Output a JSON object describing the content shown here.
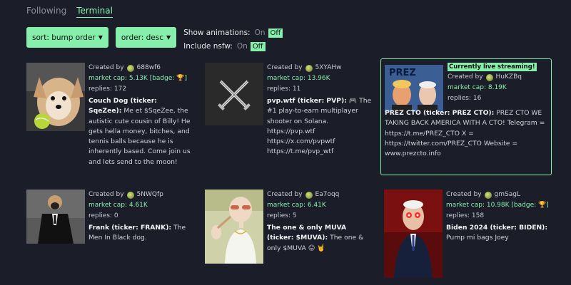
{
  "tabs": [
    "Following",
    "Terminal"
  ],
  "controls": {
    "sort_label": "sort: bump order",
    "order_label": "order: desc",
    "animations_label": "Show animations:",
    "nsfw_label": "Include nsfw:",
    "off_option": "On",
    "on_option": "Off"
  },
  "cards": [
    {
      "created_by": "Created by",
      "user": "688wf6",
      "market_cap": "market cap: 5.13K",
      "badge": "[badge: 🏆]",
      "replies": "replies: 172",
      "name": "Couch Dog (ticker: SqeZee):",
      "text": "Me et $SqeZee, the autistic cute cousin of Billy! He gets hella money, bitches, and tennis balls because he is inherently based. Come join us and lets send to the moon!"
    },
    {
      "created_by": "Created by",
      "user": "5XYAHw",
      "market_cap": "market cap: 13.96K",
      "replies": "replies: 11",
      "name": "pvp.wtf (ticker: PVP):",
      "text": "🎮 The #1 play-to-earn multiplayer shooter on Solana. https://pvp.wtf https://x.com/pvpwtf https://t.me/pvp_wtf"
    },
    {
      "live": "Currently live streaming!",
      "created_by": "Created by",
      "user": "HuKZBq",
      "market_cap": "market cap: 8.19K",
      "replies": "replies: 16",
      "name": "PREZ CTO (ticker: PREZ CTO):",
      "text": "PREZ CTO WE TAKING BACK AMERICA WITH A CTO! Telegram = https://t.me/PREZ_CTO X = https://twitter.com/PREZ_CTO Website = www.prezcto.info",
      "image_text": "PREZ"
    },
    {
      "created_by": "Created by",
      "user": "5NWQfp",
      "market_cap": "market cap: 4.61K",
      "replies": "replies: 0",
      "name": "Frank (ticker: FRANK):",
      "text": "The Men In Black dog."
    },
    {
      "created_by": "Created by",
      "user": "Ea7oqq",
      "market_cap": "market cap: 6.41K",
      "replies": "replies: 5",
      "name": "The one & only MUVA (ticker: $MUVA):",
      "text": "The one & only $MUVA 😛 🤘"
    },
    {
      "created_by": "Created by",
      "user": "gmSagL",
      "market_cap": "market cap: 10.98K",
      "badge": "[badge: 🏆]",
      "replies": "replies: 158",
      "name": "Biden 2024 (ticker: BIDEN):",
      "text": "Pump mi bags Joey"
    }
  ],
  "colors": {
    "accent": "#86efac",
    "background": "#1b1d28"
  }
}
